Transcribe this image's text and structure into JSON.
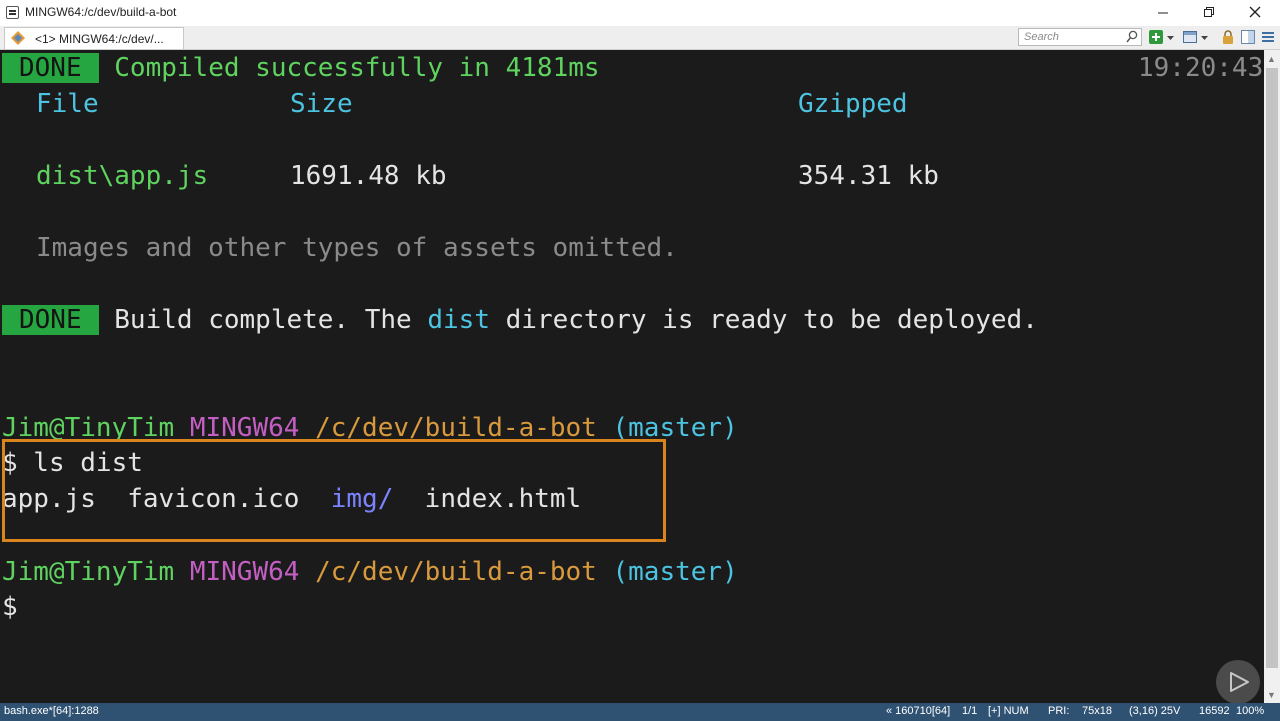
{
  "window": {
    "title": "MINGW64:/c/dev/build-a-bot",
    "minimize_icon": "minimize-icon",
    "maximize_icon": "restore-icon",
    "close_icon": "close-icon"
  },
  "toolbar": {
    "tab_label": "<1> MINGW64:/c/dev/...",
    "search_placeholder": "Search"
  },
  "terminal": {
    "line1": {
      "badge": "DONE",
      "text": "Compiled successfully in 4181ms",
      "timestamp": "19:20:43"
    },
    "header": {
      "file": "File",
      "size": "Size",
      "gzipped": "Gzipped"
    },
    "row": {
      "file": "dist\\app.js",
      "size": "1691.48 kb",
      "gzipped": "354.31 kb"
    },
    "omitted": "Images and other types of assets omitted.",
    "line_build": {
      "badge": "DONE",
      "pre": "Build complete. The ",
      "dist": "dist",
      "post": " directory is ready to be deployed."
    },
    "prompt1": {
      "user": "Jim@TinyTim",
      "shell": "MINGW64",
      "path": "/c/dev/build-a-bot",
      "branch": "(master)"
    },
    "cmd": "$ ls dist",
    "ls_output": {
      "a": "app.js",
      "b": "favicon.ico",
      "c": "img/",
      "d": "index.html"
    },
    "prompt2": {
      "user": "Jim@TinyTim",
      "shell": "MINGW64",
      "path": "/c/dev/build-a-bot",
      "branch": "(master)"
    },
    "cursor_prompt": "$"
  },
  "statusbar": {
    "left": "bash.exe*[64]:1288",
    "info": "« 160710[64]",
    "pages": "1/1",
    "mods": "[+] NUM",
    "pri": "PRI:",
    "size": "75x18",
    "cursor": "(3,16) 25V",
    "mem": "16592",
    "zoom": "100%"
  },
  "colors": {
    "done_badge": "#26a641",
    "highlight": "#d9841c",
    "status_bg": "#2f5273"
  }
}
